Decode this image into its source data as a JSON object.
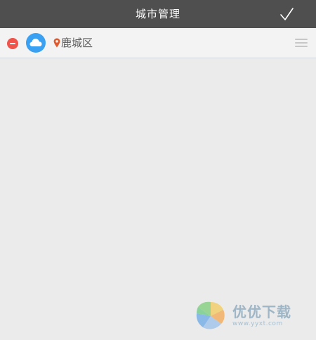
{
  "header": {
    "title": "城市管理",
    "confirm_icon": "checkmark-icon"
  },
  "cities": [
    {
      "name": "鹿城区",
      "weather_icon": "cloud-icon",
      "location_icon": "map-pin-icon",
      "remove_icon": "remove-icon",
      "drag_icon": "drag-handle-icon"
    }
  ],
  "watermark": {
    "text": "优优下载",
    "url": "www.yyxt.com"
  },
  "colors": {
    "topbar": "#4f4f4f",
    "background": "#ebebeb",
    "remove": "#ef5349",
    "weather_badge": "#3aa0f2",
    "pin": "#e25a2c"
  }
}
